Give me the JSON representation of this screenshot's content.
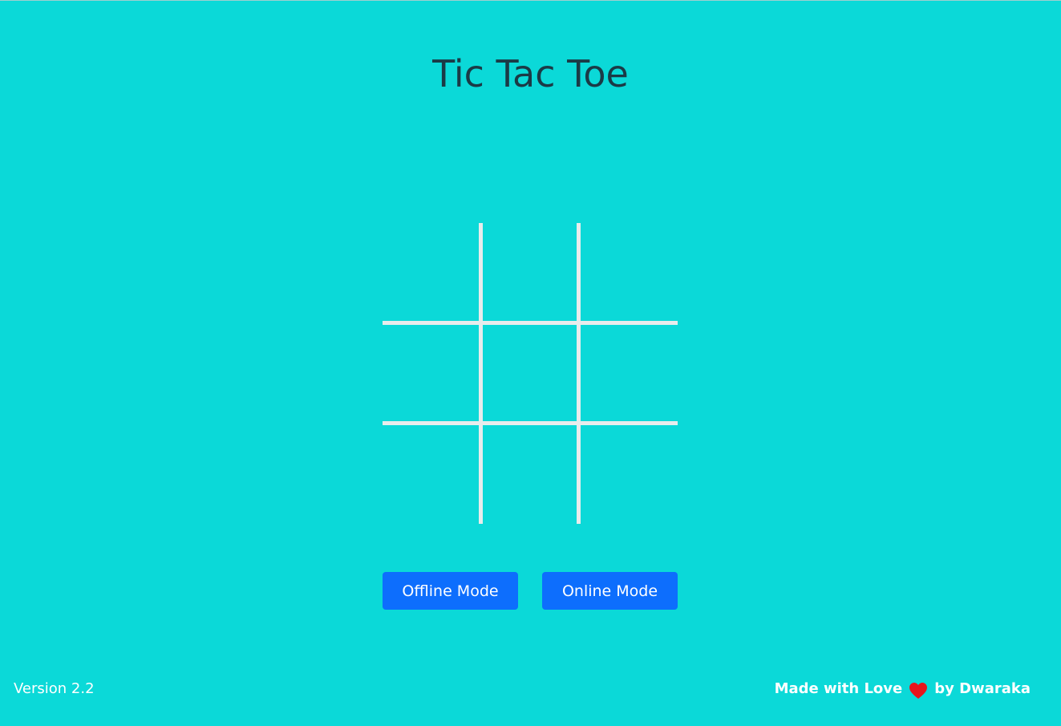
{
  "app": {
    "title": "Tic Tac Toe"
  },
  "board": {
    "cells": [
      "",
      "",
      "",
      "",
      "",
      "",
      "",
      "",
      ""
    ]
  },
  "buttons": {
    "offline_label": "Offline Mode",
    "online_label": "Online Mode"
  },
  "footer": {
    "version": "Version 2.2",
    "made_with": "Made with Love",
    "by_author": "by Dwaraka",
    "heart_icon": "heart-icon"
  },
  "colors": {
    "background": "#0bd9d8",
    "grid_line": "#e8ecec",
    "button": "#0d6efd",
    "heart": "#e8151b"
  }
}
